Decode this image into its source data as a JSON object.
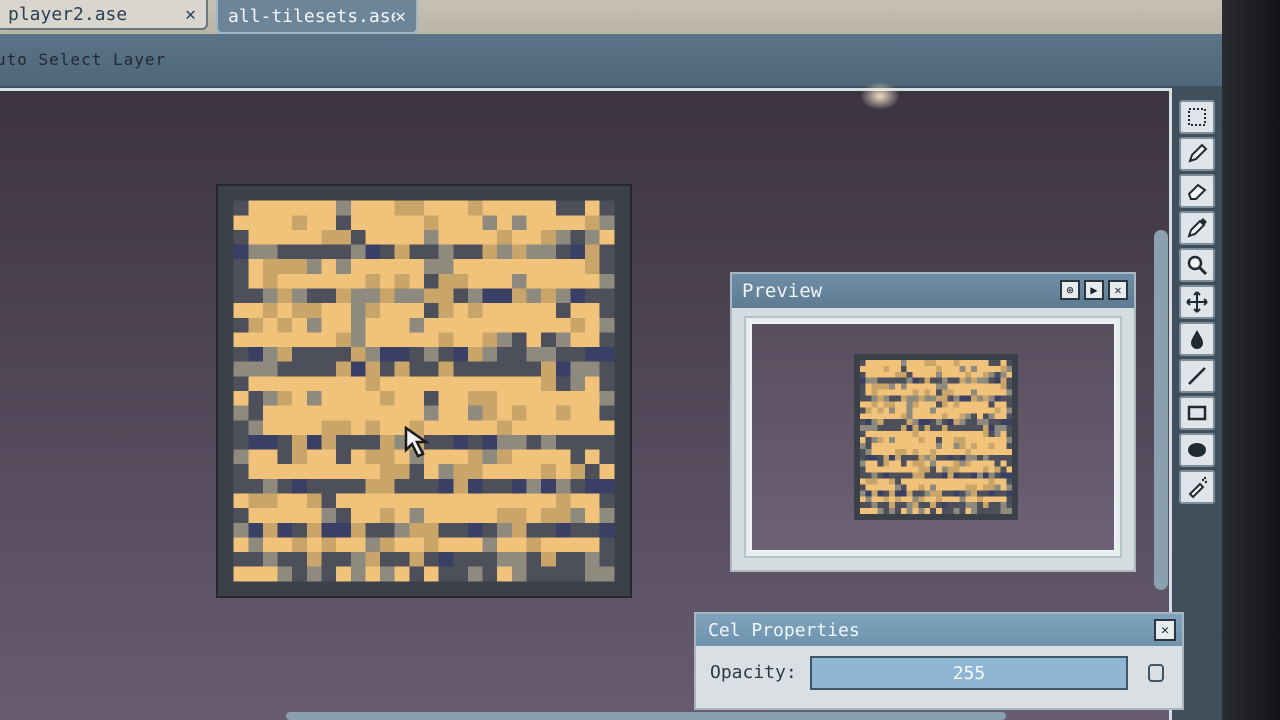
{
  "tabs": [
    {
      "label": "player2.ase",
      "close": "✕",
      "active": false
    },
    {
      "label": "all-tilesets.ase",
      "close": "✕",
      "active": true
    }
  ],
  "context_bar": {
    "label": "uto Select Layer"
  },
  "preview": {
    "title": "Preview"
  },
  "cel_properties": {
    "title": "Cel Properties",
    "opacity_label": "Opacity:",
    "opacity_value": "255"
  },
  "tools": [
    "marquee-icon",
    "pencil-icon",
    "eraser-icon",
    "eyedropper-icon",
    "zoom-icon",
    "move-icon",
    "fill-icon",
    "line-icon",
    "rectangle-icon",
    "ellipse-icon",
    "spray-icon"
  ],
  "colors": {
    "sand": "#f1c27a",
    "tan": "#c9a56a",
    "stone": "#8e8a7e",
    "shadow": "#4d4f5a",
    "navy": "#3a3f66",
    "frame": "#3b4049"
  }
}
